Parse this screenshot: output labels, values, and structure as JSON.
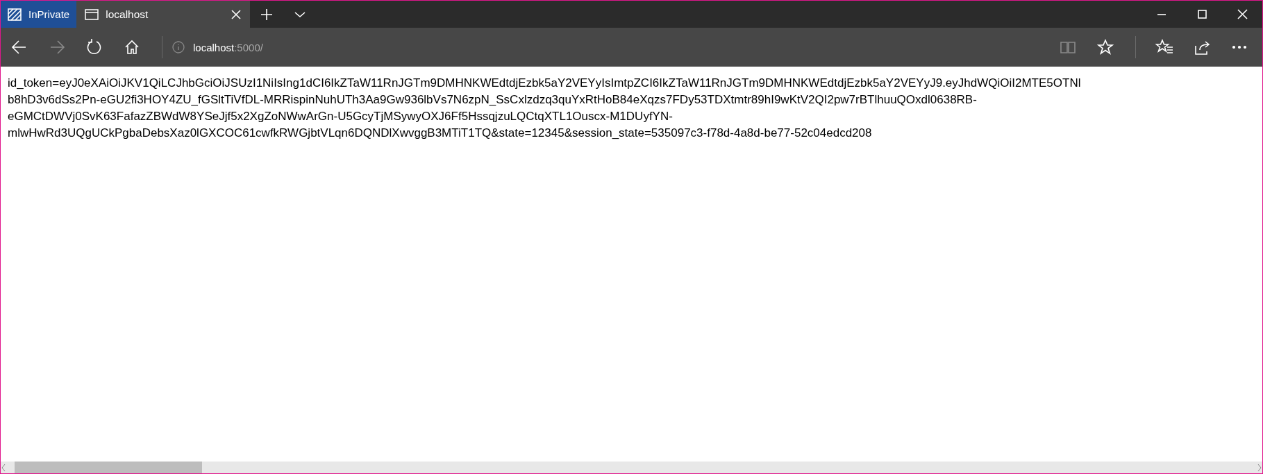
{
  "inprivate_label": "InPrivate",
  "tabs": [
    {
      "label": "localhost",
      "selected": true
    }
  ],
  "address": {
    "host": "localhost",
    "rest": ":5000/"
  },
  "content_lines": [
    "id_token=eyJ0eXAiOiJKV1QiLCJhbGciOiJSUzI1NiIsIng1dCI6IkZTaW11RnJGTm9DMHNKWEdtdjEzbk5aY2VEYyIsImtpZCI6IkZTaW11RnJGTm9DMHNKWEdtdjEzbk5aY2VEYyJ9.eyJhdWQiOiI2MTE5OTNl",
    "b8hD3v6dSs2Pn-eGU2fi3HOY4ZU_fGSltTiVfDL-MRRispinNuhUTh3Aa9Gw936lbVs7N6zpN_SsCxlzdzq3quYxRtHoB84eXqzs7FDy53TDXtmtr89hI9wKtV2QI2pw7rBTlhuuQOxdl0638RB-",
    "eGMCtDWVj0SvK63FafazZBWdW8YSeJjf5x2XgZoNWwArGn-U5GcyTjMSywyOXJ6Ff5HssqjzuLQCtqXTL1Ouscx-M1DUyfYN-",
    "mlwHwRd3UQgUCkPgbaDebsXaz0lGXCOC61cwfkRWGjbtVLqn6DQNDlXwvggB3MTiT1TQ&state=12345&session_state=535097c3-f78d-4a8d-be77-52c04edcd208"
  ]
}
